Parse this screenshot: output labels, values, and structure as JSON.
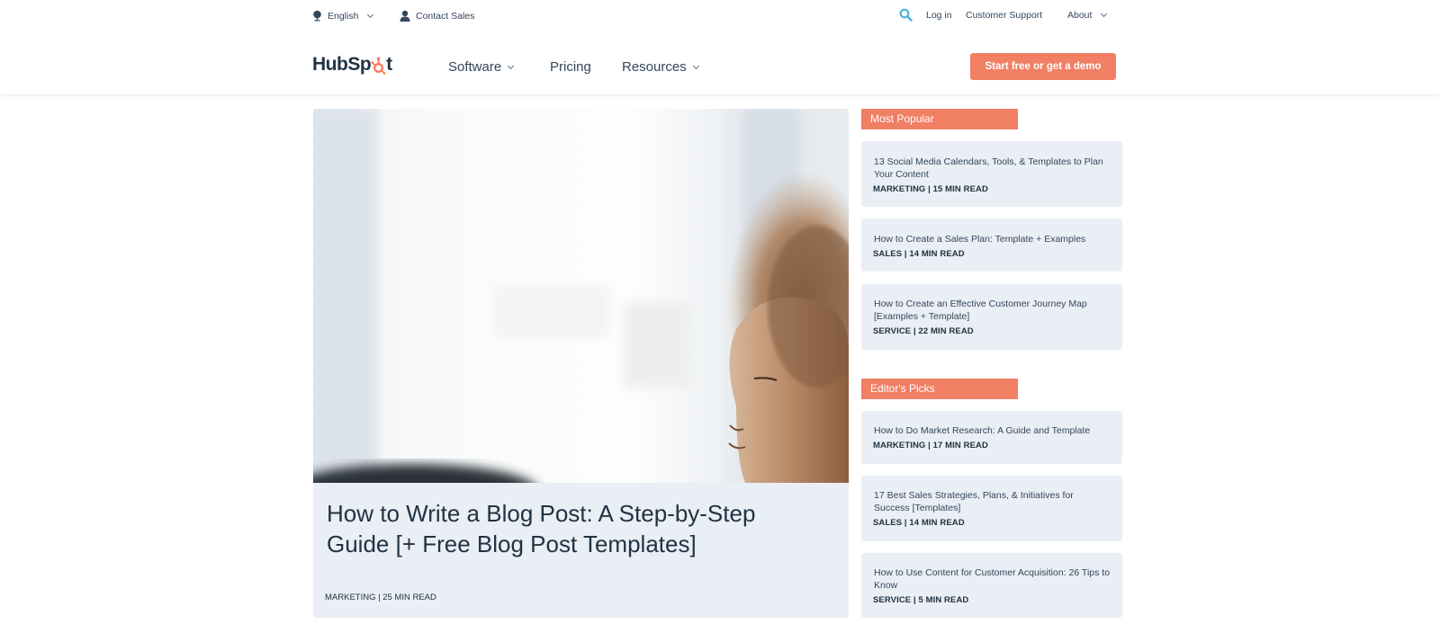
{
  "utility_bar": {
    "language": "English",
    "contact_sales": "Contact Sales",
    "login": "Log in",
    "customer_support": "Customer Support",
    "about": "About",
    "search_icon": "search-icon",
    "accent_color": "#4fb1d5"
  },
  "nav": {
    "logo_text_1": "HubSp",
    "logo_text_2": "t",
    "items": [
      {
        "label": "Software",
        "dropdown": true
      },
      {
        "label": "Pricing",
        "dropdown": false
      },
      {
        "label": "Resources",
        "dropdown": true
      }
    ],
    "cta_label": "Start free or get a demo",
    "cta_color": "#f07f63"
  },
  "feature": {
    "title": "How to Write a Blog Post: A Step-by-Step Guide [+ Free Blog Post Templates]",
    "meta": "MARKETING | 25 MIN READ",
    "image_alt": "woman with curly hair looking down"
  },
  "sidebar": {
    "most_popular": {
      "label": "Most Popular",
      "items": [
        {
          "title": "13 Social Media Calendars, Tools, & Templates to Plan Your Content",
          "meta": "MARKETING | 15 MIN READ"
        },
        {
          "title": "How to Create a Sales Plan: Template + Examples",
          "meta": "SALES | 14 MIN READ"
        },
        {
          "title": "How to Create an Effective Customer Journey Map [Examples + Template]",
          "meta": "SERVICE | 22 MIN READ"
        }
      ]
    },
    "editors_picks": {
      "label": "Editor's Picks",
      "items": [
        {
          "title": "How to Do Market Research: A Guide and Template",
          "meta": "MARKETING | 17 MIN READ"
        },
        {
          "title": "17 Best Sales Strategies, Plans, & Initiatives for Success [Templates]",
          "meta": "SALES | 14 MIN READ"
        },
        {
          "title": "How to Use Content for Customer Acquisition: 26 Tips to Know",
          "meta": "SERVICE | 5 MIN READ"
        }
      ]
    }
  }
}
